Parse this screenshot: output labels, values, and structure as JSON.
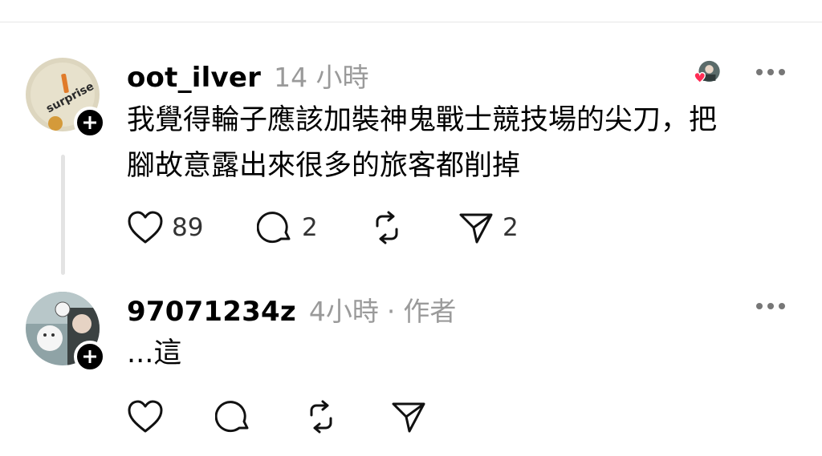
{
  "comments": [
    {
      "username": "oot_ilver",
      "time": "14 小時",
      "author_tag": "",
      "line1": "我覺得輪子應該加裝神鬼戰士競技場的尖刀，把",
      "line2": "腳故意露出來很多的旅客都削掉",
      "likes": "89",
      "replies": "2",
      "reposts": "",
      "shares": "2",
      "avatar_text": "surprise"
    },
    {
      "username": "97071234z",
      "time": "4小時",
      "separator": "·",
      "author_tag": "作者",
      "line1": "...這",
      "likes": "",
      "replies": "",
      "reposts": "",
      "shares": ""
    }
  ],
  "colors": {
    "like_heart": "#ff2d55",
    "plus_badge": "#000000",
    "meta_gray": "#9a9a9a"
  },
  "icons": [
    "heart-icon",
    "comment-bubble-icon",
    "repost-icon",
    "share-icon",
    "plus-icon",
    "more-icon"
  ]
}
